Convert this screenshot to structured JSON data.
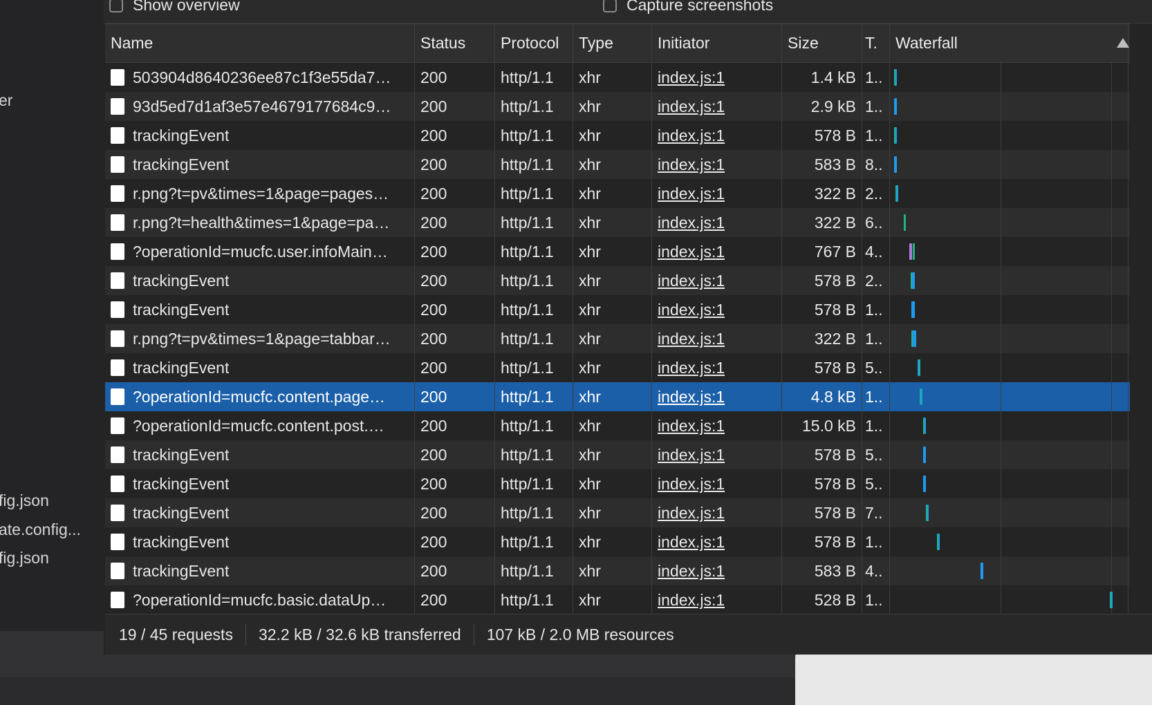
{
  "left_panel": {
    "items": [
      "er",
      "fig.json",
      "ate.config...",
      "fig.json"
    ]
  },
  "toolbar": {
    "show_overview_label": "Show overview",
    "capture_screenshots_label": "Capture screenshots"
  },
  "table": {
    "columns": {
      "name": "Name",
      "status": "Status",
      "protocol": "Protocol",
      "type": "Type",
      "initiator": "Initiator",
      "size": "Size",
      "time": "T.",
      "waterfall": "Waterfall"
    },
    "rows": [
      {
        "name": "503904d8640236ee87c1f3e55da7…",
        "status": "200",
        "protocol": "http/1.1",
        "type": "xhr",
        "initiator": "index.js:1",
        "size": "1.4 kB",
        "time": "1.."
      },
      {
        "name": "93d5ed7d1af3e57e4679177684c9…",
        "status": "200",
        "protocol": "http/1.1",
        "type": "xhr",
        "initiator": "index.js:1",
        "size": "2.9 kB",
        "time": "1.."
      },
      {
        "name": "trackingEvent",
        "status": "200",
        "protocol": "http/1.1",
        "type": "xhr",
        "initiator": "index.js:1",
        "size": "578 B",
        "time": "1.."
      },
      {
        "name": "trackingEvent",
        "status": "200",
        "protocol": "http/1.1",
        "type": "xhr",
        "initiator": "index.js:1",
        "size": "583 B",
        "time": "8.."
      },
      {
        "name": "r.png?t=pv&times=1&page=pages…",
        "status": "200",
        "protocol": "http/1.1",
        "type": "xhr",
        "initiator": "index.js:1",
        "size": "322 B",
        "time": "2.."
      },
      {
        "name": "r.png?t=health&times=1&page=pa…",
        "status": "200",
        "protocol": "http/1.1",
        "type": "xhr",
        "initiator": "index.js:1",
        "size": "322 B",
        "time": "6.."
      },
      {
        "name": "?operationId=mucfc.user.infoMain…",
        "status": "200",
        "protocol": "http/1.1",
        "type": "xhr",
        "initiator": "index.js:1",
        "size": "767 B",
        "time": "4.."
      },
      {
        "name": "trackingEvent",
        "status": "200",
        "protocol": "http/1.1",
        "type": "xhr",
        "initiator": "index.js:1",
        "size": "578 B",
        "time": "2.."
      },
      {
        "name": "trackingEvent",
        "status": "200",
        "protocol": "http/1.1",
        "type": "xhr",
        "initiator": "index.js:1",
        "size": "578 B",
        "time": "1.."
      },
      {
        "name": "r.png?t=pv&times=1&page=tabbar…",
        "status": "200",
        "protocol": "http/1.1",
        "type": "xhr",
        "initiator": "index.js:1",
        "size": "322 B",
        "time": "1.."
      },
      {
        "name": "trackingEvent",
        "status": "200",
        "protocol": "http/1.1",
        "type": "xhr",
        "initiator": "index.js:1",
        "size": "578 B",
        "time": "5.."
      },
      {
        "name": "?operationId=mucfc.content.page…",
        "status": "200",
        "protocol": "http/1.1",
        "type": "xhr",
        "initiator": "index.js:1",
        "size": "4.8 kB",
        "time": "1..",
        "selected": true
      },
      {
        "name": "?operationId=mucfc.content.post.…",
        "status": "200",
        "protocol": "http/1.1",
        "type": "xhr",
        "initiator": "index.js:1",
        "size": "15.0 kB",
        "time": "1.."
      },
      {
        "name": "trackingEvent",
        "status": "200",
        "protocol": "http/1.1",
        "type": "xhr",
        "initiator": "index.js:1",
        "size": "578 B",
        "time": "5.."
      },
      {
        "name": "trackingEvent",
        "status": "200",
        "protocol": "http/1.1",
        "type": "xhr",
        "initiator": "index.js:1",
        "size": "578 B",
        "time": "5.."
      },
      {
        "name": "trackingEvent",
        "status": "200",
        "protocol": "http/1.1",
        "type": "xhr",
        "initiator": "index.js:1",
        "size": "578 B",
        "time": "7.."
      },
      {
        "name": "trackingEvent",
        "status": "200",
        "protocol": "http/1.1",
        "type": "xhr",
        "initiator": "index.js:1",
        "size": "578 B",
        "time": "1.."
      },
      {
        "name": "trackingEvent",
        "status": "200",
        "protocol": "http/1.1",
        "type": "xhr",
        "initiator": "index.js:1",
        "size": "583 B",
        "time": "4.."
      },
      {
        "name": "?operationId=mucfc.basic.dataUp…",
        "status": "200",
        "protocol": "http/1.1",
        "type": "xhr",
        "initiator": "index.js:1",
        "size": "528 B",
        "time": "1.."
      }
    ]
  },
  "footer": {
    "requests": "19 / 45 requests",
    "transferred": "32.2 kB / 32.6 kB transferred",
    "resources": "107 kB / 2.0 MB resources"
  },
  "colors": {
    "selected_row": "#1b5fa8",
    "waterfall_blue": "#1e9bf0",
    "waterfall_green": "#1fb38a",
    "waterfall_purple": "#b07ad8"
  }
}
